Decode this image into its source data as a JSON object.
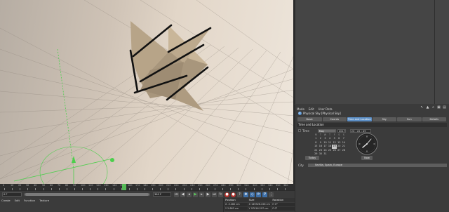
{
  "attributes": {
    "menu": [
      "Mode",
      "Edit",
      "User Data"
    ],
    "object_name": "Physical Sky [Physical Sky]",
    "tabs": [
      {
        "label": "Basic",
        "active": false
      },
      {
        "label": "Coords",
        "active": false
      },
      {
        "label": "Time and Location",
        "active": true
      },
      {
        "label": "Sky",
        "active": false
      },
      {
        "label": "Sun",
        "active": false
      },
      {
        "label": "Details",
        "active": false
      }
    ],
    "section_title": "Time and Location",
    "time_label": "Time",
    "month": "May",
    "year": "2017",
    "time_value": "20 : 22 : 49",
    "calendar_headers": [
      "M",
      "T",
      "W",
      "T",
      "F",
      "S",
      "S"
    ],
    "calendar_days": [
      "1",
      "2",
      "3",
      "4",
      "5",
      "6",
      "7",
      "8",
      "9",
      "10",
      "11",
      "12",
      "13",
      "14",
      "15",
      "16",
      "17",
      "18",
      "19",
      "20",
      "21",
      "22",
      "23",
      "24",
      "25",
      "26",
      "27",
      "28",
      "29",
      "30",
      "31"
    ],
    "selected_day": "19",
    "today_label": "Today",
    "now_label": "Now",
    "city_label": "City",
    "city_value": "Sevilla, Spain, Europe"
  },
  "timeline": {
    "labels": [
      "0",
      "10",
      "20",
      "30",
      "40",
      "50",
      "60",
      "70",
      "80",
      "90",
      "100",
      "110",
      "120",
      "130",
      "140",
      "150",
      "160",
      "170",
      "180",
      "190",
      "200",
      "210",
      "220",
      "230",
      "240",
      "250",
      "260",
      "270",
      "280",
      "290",
      "300",
      "310",
      "320",
      "330",
      "340",
      "350",
      "360"
    ],
    "current_frame": "151 F",
    "start_frame": "0 F",
    "end_frame": "360 F",
    "right_end": "360 F"
  },
  "material_menu": [
    "Create",
    "Edit",
    "Function",
    "Texture"
  ],
  "coordinates": {
    "headers": [
      "Position",
      "Size",
      "Rotation"
    ],
    "rows": [
      [
        "X -5.282 cm",
        "X 149326.226 cm",
        "H 0°"
      ],
      [
        "Y 2.863 cm",
        "Y 97016.297 cm",
        "P 0°"
      ]
    ]
  },
  "colors": {
    "active_tab": "#5c8fc6",
    "playhead": "#5bd05b",
    "record": "#b8332e",
    "object": "#b7a488"
  }
}
